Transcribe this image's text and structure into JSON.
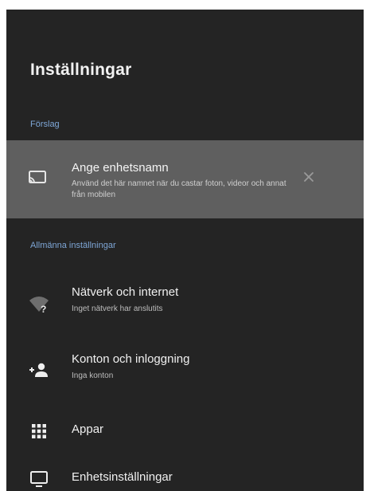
{
  "header": {
    "title": "Inställningar"
  },
  "suggestions": {
    "section_label": "Förslag",
    "card": {
      "icon": "cast-screen-icon",
      "title": "Ange enhetsnamn",
      "subtitle": "Använd det här namnet när du castar foton, videor och annat från mobilen",
      "dismiss_icon": "close-icon"
    }
  },
  "general": {
    "section_label": "Allmänna inställningar",
    "items": [
      {
        "icon": "wifi-unknown-icon",
        "title": "Nätverk och internet",
        "subtitle": "Inget nätverk har anslutits"
      },
      {
        "icon": "add-person-icon",
        "title": "Konton och inloggning",
        "subtitle": "Inga konton"
      },
      {
        "icon": "apps-grid-icon",
        "title": "Appar"
      },
      {
        "icon": "tv-display-icon",
        "title": "Enhetsinställningar"
      }
    ]
  },
  "colors": {
    "background": "#242424",
    "card_highlight": "#5f5f5f",
    "section_accent": "#7ea6d6"
  }
}
